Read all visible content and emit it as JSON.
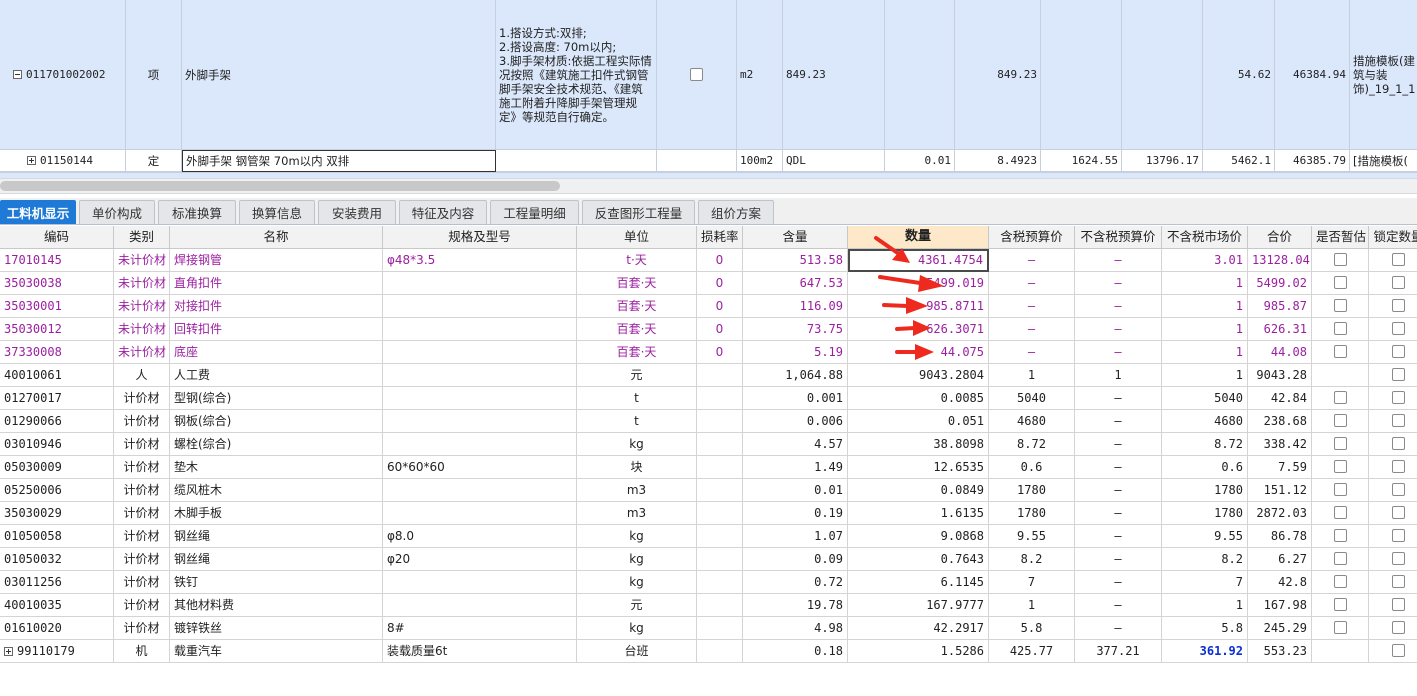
{
  "top_rows": [
    {
      "code": "011701002002",
      "type": "项",
      "name": "外脚手架",
      "feature": "1.搭设方式:双排;\n2.搭设高度: 70m以内;\n3.脚手架材质:依据工程实际情况按照《建筑施工扣件式钢管脚手架安全技术规范、《建筑施工附着升降脚手架管理规定》等规范自行确定。",
      "unit": "m2",
      "expr": "849.23",
      "c1": "",
      "qty": "849.23",
      "c3": "",
      "c4": "",
      "unit_price": "54.62",
      "total": "46384.94",
      "profession": "措施模板(建筑与装饰)_19_1_1"
    },
    {
      "code": "01150144",
      "type": "定",
      "name": "外脚手架 钢管架 70m以内 双排",
      "unit": "100m2",
      "expr": "QDL",
      "content": "0.01",
      "qty": "8.4923",
      "p1": "1624.55",
      "p2": "13796.17",
      "unit_price": "5462.1",
      "total": "46385.79",
      "profession": "[措施模板("
    }
  ],
  "tabs": [
    "工料机显示",
    "单价构成",
    "标准换算",
    "换算信息",
    "安装费用",
    "特征及内容",
    "工程量明细",
    "反查图形工程量",
    "组价方案"
  ],
  "columns": [
    "编码",
    "类别",
    "名称",
    "规格及型号",
    "单位",
    "损耗率",
    "含量",
    "数量",
    "含税预算价",
    "不含税预算价",
    "不含税市场价",
    "合价",
    "是否暂估",
    "锁定数量"
  ],
  "rows": [
    {
      "code": "17010145",
      "cat": "未计价材",
      "name": "焊接钢管",
      "spec": "φ48*3.5",
      "unit": "t·天",
      "loss": "0",
      "content": "513.58",
      "qty": "4361.4754",
      "tax_price": "—",
      "notax_price": "—",
      "market": "3.01",
      "total": "13128.04",
      "est": true,
      "lock": true,
      "purple": true
    },
    {
      "code": "35030038",
      "cat": "未计价材",
      "name": "直角扣件",
      "spec": "",
      "unit": "百套·天",
      "loss": "0",
      "content": "647.53",
      "qty": "5499.019",
      "tax_price": "—",
      "notax_price": "—",
      "market": "1",
      "total": "5499.02",
      "est": true,
      "lock": true,
      "purple": true
    },
    {
      "code": "35030001",
      "cat": "未计价材",
      "name": "对接扣件",
      "spec": "",
      "unit": "百套·天",
      "loss": "0",
      "content": "116.09",
      "qty": "985.8711",
      "tax_price": "—",
      "notax_price": "—",
      "market": "1",
      "total": "985.87",
      "est": true,
      "lock": true,
      "purple": true
    },
    {
      "code": "35030012",
      "cat": "未计价材",
      "name": "回转扣件",
      "spec": "",
      "unit": "百套·天",
      "loss": "0",
      "content": "73.75",
      "qty": "626.3071",
      "tax_price": "—",
      "notax_price": "—",
      "market": "1",
      "total": "626.31",
      "est": true,
      "lock": true,
      "purple": true
    },
    {
      "code": "37330008",
      "cat": "未计价材",
      "name": "底座",
      "spec": "",
      "unit": "百套·天",
      "loss": "0",
      "content": "5.19",
      "qty": "44.075",
      "tax_price": "—",
      "notax_price": "—",
      "market": "1",
      "total": "44.08",
      "est": true,
      "lock": true,
      "purple": true
    },
    {
      "code": "40010061",
      "cat": "人",
      "name": "人工费",
      "spec": "",
      "unit": "元",
      "loss": "",
      "content": "1,064.88",
      "qty": "9043.2804",
      "tax_price": "1",
      "notax_price": "1",
      "market": "1",
      "total": "9043.28",
      "est": false,
      "lock": true,
      "purple": false
    },
    {
      "code": "01270017",
      "cat": "计价材",
      "name": "型钢(综合)",
      "spec": "",
      "unit": "t",
      "loss": "",
      "content": "0.001",
      "qty": "0.0085",
      "tax_price": "5040",
      "notax_price": "—",
      "market": "5040",
      "total": "42.84",
      "est": true,
      "lock": true,
      "purple": false
    },
    {
      "code": "01290066",
      "cat": "计价材",
      "name": "钢板(综合)",
      "spec": "",
      "unit": "t",
      "loss": "",
      "content": "0.006",
      "qty": "0.051",
      "tax_price": "4680",
      "notax_price": "—",
      "market": "4680",
      "total": "238.68",
      "est": true,
      "lock": true,
      "purple": false
    },
    {
      "code": "03010946",
      "cat": "计价材",
      "name": "螺栓(综合)",
      "spec": "",
      "unit": "kg",
      "loss": "",
      "content": "4.57",
      "qty": "38.8098",
      "tax_price": "8.72",
      "notax_price": "—",
      "market": "8.72",
      "total": "338.42",
      "est": true,
      "lock": true,
      "purple": false
    },
    {
      "code": "05030009",
      "cat": "计价材",
      "name": "垫木",
      "spec": "60*60*60",
      "unit": "块",
      "loss": "",
      "content": "1.49",
      "qty": "12.6535",
      "tax_price": "0.6",
      "notax_price": "—",
      "market": "0.6",
      "total": "7.59",
      "est": true,
      "lock": true,
      "purple": false
    },
    {
      "code": "05250006",
      "cat": "计价材",
      "name": "缆风桩木",
      "spec": "",
      "unit": "m3",
      "loss": "",
      "content": "0.01",
      "qty": "0.0849",
      "tax_price": "1780",
      "notax_price": "—",
      "market": "1780",
      "total": "151.12",
      "est": true,
      "lock": true,
      "purple": false
    },
    {
      "code": "35030029",
      "cat": "计价材",
      "name": "木脚手板",
      "spec": "",
      "unit": "m3",
      "loss": "",
      "content": "0.19",
      "qty": "1.6135",
      "tax_price": "1780",
      "notax_price": "—",
      "market": "1780",
      "total": "2872.03",
      "est": true,
      "lock": true,
      "purple": false
    },
    {
      "code": "01050058",
      "cat": "计价材",
      "name": "钢丝绳",
      "spec": "φ8.0",
      "unit": "kg",
      "loss": "",
      "content": "1.07",
      "qty": "9.0868",
      "tax_price": "9.55",
      "notax_price": "—",
      "market": "9.55",
      "total": "86.78",
      "est": true,
      "lock": true,
      "purple": false
    },
    {
      "code": "01050032",
      "cat": "计价材",
      "name": "钢丝绳",
      "spec": "φ20",
      "unit": "kg",
      "loss": "",
      "content": "0.09",
      "qty": "0.7643",
      "tax_price": "8.2",
      "notax_price": "—",
      "market": "8.2",
      "total": "6.27",
      "est": true,
      "lock": true,
      "purple": false
    },
    {
      "code": "03011256",
      "cat": "计价材",
      "name": "铁钉",
      "spec": "",
      "unit": "kg",
      "loss": "",
      "content": "0.72",
      "qty": "6.1145",
      "tax_price": "7",
      "notax_price": "—",
      "market": "7",
      "total": "42.8",
      "est": true,
      "lock": true,
      "purple": false
    },
    {
      "code": "40010035",
      "cat": "计价材",
      "name": "其他材料费",
      "spec": "",
      "unit": "元",
      "loss": "",
      "content": "19.78",
      "qty": "167.9777",
      "tax_price": "1",
      "notax_price": "—",
      "market": "1",
      "total": "167.98",
      "est": true,
      "lock": true,
      "purple": false
    },
    {
      "code": "01610020",
      "cat": "计价材",
      "name": "镀锌铁丝",
      "spec": "8#",
      "unit": "kg",
      "loss": "",
      "content": "4.98",
      "qty": "42.2917",
      "tax_price": "5.8",
      "notax_price": "—",
      "market": "5.8",
      "total": "245.29",
      "est": true,
      "lock": true,
      "purple": false
    },
    {
      "code": "99110179",
      "cat": "机",
      "name": "载重汽车",
      "spec": "装载质量6t",
      "unit": "台班",
      "loss": "",
      "content": "0.18",
      "qty": "1.5286",
      "tax_price": "425.77",
      "notax_price": "377.21",
      "market": "361.92",
      "total": "553.23",
      "est": false,
      "lock": true,
      "purple": false,
      "expandable": true,
      "market_blue": true
    }
  ],
  "annotation_color": "#ee2a1f",
  "accent": "#1e7ad6"
}
